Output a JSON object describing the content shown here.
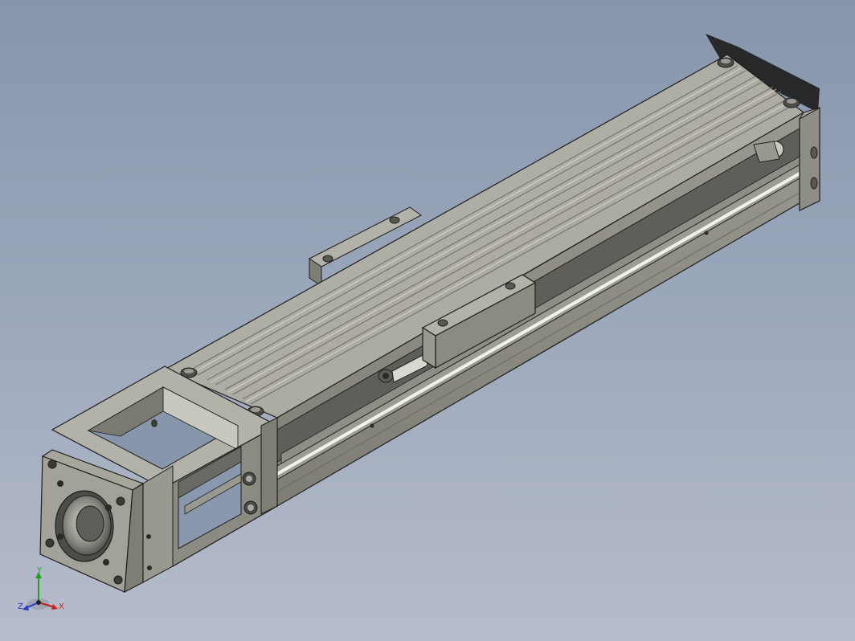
{
  "viewport": {
    "background_top": "#8796ac",
    "background_bottom": "#b6bccb",
    "model": "linear-actuator-assembly"
  },
  "colors": {
    "face_top": "#aeada3",
    "face_side": "#8c8b82",
    "face_dark": "#6a6963",
    "edge": "#1e1e1e",
    "highlight": "#f2f2ec",
    "shadow": "#1c1c1c"
  },
  "triad": {
    "x_label": "X",
    "y_label": "Y",
    "z_label": "Z",
    "x_color": "#c81e1e",
    "y_color": "#1fa01f",
    "z_color": "#2838c8"
  }
}
